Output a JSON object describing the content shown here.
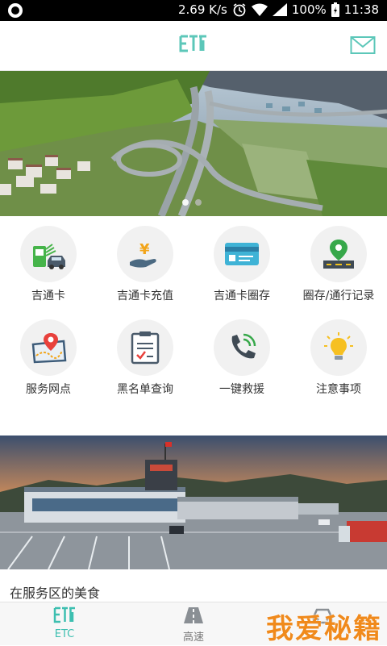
{
  "status_bar": {
    "speed": "2.69 K/s",
    "battery": "100%",
    "time": "11:38"
  },
  "header": {
    "logo_text": "ETC",
    "mail_icon": "mail-icon",
    "accent_color": "#5cc7b9"
  },
  "banner": {
    "image": "highway-interchange-landscape",
    "dots": 2,
    "active_dot": 0
  },
  "grid": {
    "items": [
      {
        "label": "吉通卡",
        "icon": "card-car-icon"
      },
      {
        "label": "吉通卡充值",
        "icon": "yen-hand-icon"
      },
      {
        "label": "吉通卡圈存",
        "icon": "id-card-icon"
      },
      {
        "label": "圈存/通行记录",
        "icon": "road-pin-icon"
      },
      {
        "label": "服务网点",
        "icon": "map-pin-icon"
      },
      {
        "label": "黑名单查询",
        "icon": "clipboard-check-icon"
      },
      {
        "label": "一键救援",
        "icon": "phone-call-icon"
      },
      {
        "label": "注意事项",
        "icon": "lightbulb-icon"
      }
    ]
  },
  "service_area": {
    "image": "service-area-building-photo",
    "title": "在服务区的美食"
  },
  "tabbar": {
    "tabs": [
      {
        "label": "ETC",
        "icon": "etc-icon",
        "active": true
      },
      {
        "label": "高速",
        "icon": "road-icon",
        "active": false
      },
      {
        "label": "",
        "icon": "car-icon",
        "active": false
      }
    ]
  },
  "watermark": "我爱秘籍"
}
